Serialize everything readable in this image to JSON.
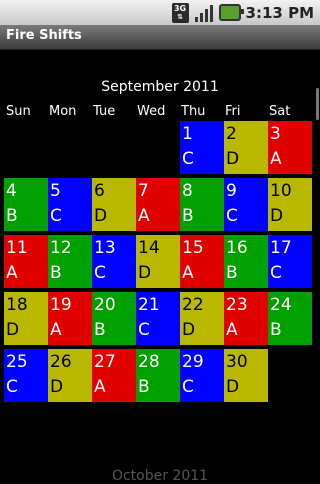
{
  "status_bar": {
    "time": "3:13 PM",
    "network": "3G"
  },
  "title_bar": {
    "title": "Fire Shifts"
  },
  "calendar": {
    "month_title": "September 2011",
    "weekdays": [
      "Sun",
      "Mon",
      "Tue",
      "Wed",
      "Thu",
      "Fri",
      "Sat"
    ],
    "days": [
      {
        "day": "1",
        "shift": "C",
        "color": "#0000ff"
      },
      {
        "day": "2",
        "shift": "D",
        "color": "#b8b800"
      },
      {
        "day": "3",
        "shift": "A",
        "color": "#e00000"
      },
      {
        "day": "4",
        "shift": "B",
        "color": "#00a000"
      },
      {
        "day": "5",
        "shift": "C",
        "color": "#0000ff"
      },
      {
        "day": "6",
        "shift": "D",
        "color": "#b8b800"
      },
      {
        "day": "7",
        "shift": "A",
        "color": "#e00000"
      },
      {
        "day": "8",
        "shift": "B",
        "color": "#00a000"
      },
      {
        "day": "9",
        "shift": "C",
        "color": "#0000ff"
      },
      {
        "day": "10",
        "shift": "D",
        "color": "#b8b800"
      },
      {
        "day": "11",
        "shift": "A",
        "color": "#e00000"
      },
      {
        "day": "12",
        "shift": "B",
        "color": "#00a000"
      },
      {
        "day": "13",
        "shift": "C",
        "color": "#0000ff"
      },
      {
        "day": "14",
        "shift": "D",
        "color": "#b8b800"
      },
      {
        "day": "15",
        "shift": "A",
        "color": "#e00000"
      },
      {
        "day": "16",
        "shift": "B",
        "color": "#00a000"
      },
      {
        "day": "17",
        "shift": "C",
        "color": "#0000ff"
      },
      {
        "day": "18",
        "shift": "D",
        "color": "#b8b800"
      },
      {
        "day": "19",
        "shift": "A",
        "color": "#e00000"
      },
      {
        "day": "20",
        "shift": "B",
        "color": "#00a000"
      },
      {
        "day": "21",
        "shift": "C",
        "color": "#0000ff"
      },
      {
        "day": "22",
        "shift": "D",
        "color": "#b8b800"
      },
      {
        "day": "23",
        "shift": "A",
        "color": "#e00000"
      },
      {
        "day": "24",
        "shift": "B",
        "color": "#00a000"
      },
      {
        "day": "25",
        "shift": "C",
        "color": "#0000ff"
      },
      {
        "day": "26",
        "shift": "D",
        "color": "#b8b800"
      },
      {
        "day": "27",
        "shift": "A",
        "color": "#e00000"
      },
      {
        "day": "28",
        "shift": "B",
        "color": "#00a000"
      },
      {
        "day": "29",
        "shift": "C",
        "color": "#0000ff"
      },
      {
        "day": "30",
        "shift": "D",
        "color": "#b8b800"
      }
    ]
  },
  "next_month_title": "October 2011"
}
